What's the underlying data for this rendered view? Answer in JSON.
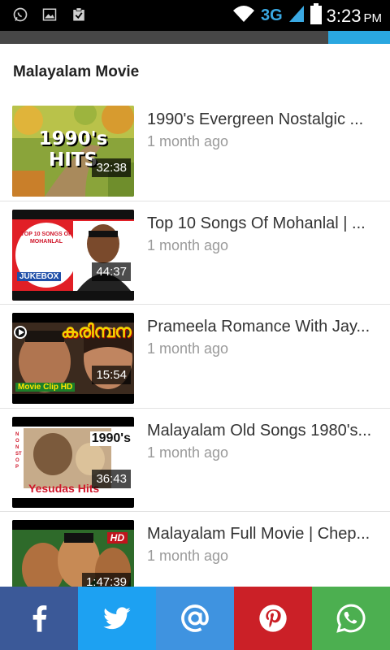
{
  "status_bar": {
    "network": "3G",
    "time": "3:23",
    "ampm": "PM",
    "icons": [
      "whatsapp-icon",
      "image-icon",
      "clipboard-check-icon",
      "wifi-icon",
      "signal-icon",
      "battery-icon"
    ]
  },
  "progress": {
    "fraction": 0.158
  },
  "section": {
    "title": "Malayalam Movie"
  },
  "videos": [
    {
      "title": "1990's Evergreen Nostalgic ...",
      "age": "1 month ago",
      "duration": "32:38",
      "thumb_text": "1990's HITS"
    },
    {
      "title": "Top 10 Songs Of Mohanlal | ...",
      "age": "1 month ago",
      "duration": "44:37",
      "thumb_text": "TOP 10 SONGS OF MOHANLAL",
      "thumb_text2": "JUKEBOX"
    },
    {
      "title": "Prameela Romance With Jay...",
      "age": "1 month ago",
      "duration": "15:54",
      "thumb_text": "കരിമ്പന",
      "thumb_text2": "Movie Clip HD"
    },
    {
      "title": "Malayalam Old Songs 1980's...",
      "age": "1 month ago",
      "duration": "36:43",
      "thumb_text": "1990's",
      "thumb_text2": "Yesudas Hits",
      "thumb_text3": "NON STOP"
    },
    {
      "title": "Malayalam Full Movie | Chep...",
      "age": "1 month ago",
      "duration": "1:47:39",
      "thumb_text": "HD"
    }
  ],
  "share": {
    "colors": {
      "facebook": "#3b5998",
      "twitter": "#1da1f2",
      "email": "#3f93e0",
      "pinterest": "#cb2027",
      "whatsapp": "#4caf50"
    }
  }
}
